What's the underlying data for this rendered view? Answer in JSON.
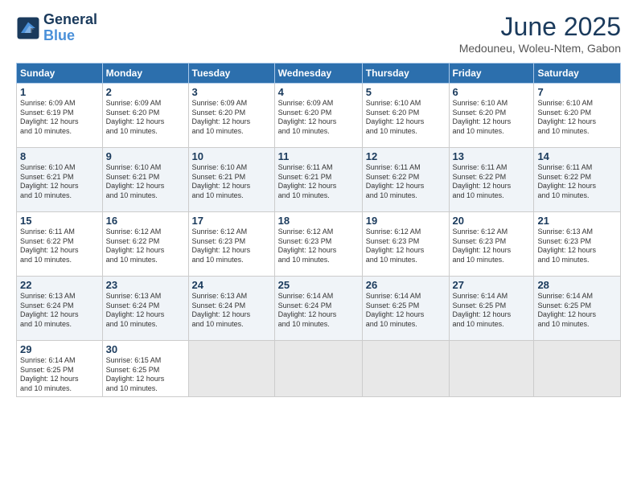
{
  "logo": {
    "line1": "General",
    "line2": "Blue"
  },
  "title": "June 2025",
  "subtitle": "Medouneu, Woleu-Ntem, Gabon",
  "header_days": [
    "Sunday",
    "Monday",
    "Tuesday",
    "Wednesday",
    "Thursday",
    "Friday",
    "Saturday"
  ],
  "weeks": [
    [
      {
        "day": "1",
        "sunrise": "6:09 AM",
        "sunset": "6:19 PM",
        "daylight": "12 hours and 10 minutes."
      },
      {
        "day": "2",
        "sunrise": "6:09 AM",
        "sunset": "6:20 PM",
        "daylight": "12 hours and 10 minutes."
      },
      {
        "day": "3",
        "sunrise": "6:09 AM",
        "sunset": "6:20 PM",
        "daylight": "12 hours and 10 minutes."
      },
      {
        "day": "4",
        "sunrise": "6:09 AM",
        "sunset": "6:20 PM",
        "daylight": "12 hours and 10 minutes."
      },
      {
        "day": "5",
        "sunrise": "6:10 AM",
        "sunset": "6:20 PM",
        "daylight": "12 hours and 10 minutes."
      },
      {
        "day": "6",
        "sunrise": "6:10 AM",
        "sunset": "6:20 PM",
        "daylight": "12 hours and 10 minutes."
      },
      {
        "day": "7",
        "sunrise": "6:10 AM",
        "sunset": "6:20 PM",
        "daylight": "12 hours and 10 minutes."
      }
    ],
    [
      {
        "day": "8",
        "sunrise": "6:10 AM",
        "sunset": "6:21 PM",
        "daylight": "12 hours and 10 minutes."
      },
      {
        "day": "9",
        "sunrise": "6:10 AM",
        "sunset": "6:21 PM",
        "daylight": "12 hours and 10 minutes."
      },
      {
        "day": "10",
        "sunrise": "6:10 AM",
        "sunset": "6:21 PM",
        "daylight": "12 hours and 10 minutes."
      },
      {
        "day": "11",
        "sunrise": "6:11 AM",
        "sunset": "6:21 PM",
        "daylight": "12 hours and 10 minutes."
      },
      {
        "day": "12",
        "sunrise": "6:11 AM",
        "sunset": "6:22 PM",
        "daylight": "12 hours and 10 minutes."
      },
      {
        "day": "13",
        "sunrise": "6:11 AM",
        "sunset": "6:22 PM",
        "daylight": "12 hours and 10 minutes."
      },
      {
        "day": "14",
        "sunrise": "6:11 AM",
        "sunset": "6:22 PM",
        "daylight": "12 hours and 10 minutes."
      }
    ],
    [
      {
        "day": "15",
        "sunrise": "6:11 AM",
        "sunset": "6:22 PM",
        "daylight": "12 hours and 10 minutes."
      },
      {
        "day": "16",
        "sunrise": "6:12 AM",
        "sunset": "6:22 PM",
        "daylight": "12 hours and 10 minutes."
      },
      {
        "day": "17",
        "sunrise": "6:12 AM",
        "sunset": "6:23 PM",
        "daylight": "12 hours and 10 minutes."
      },
      {
        "day": "18",
        "sunrise": "6:12 AM",
        "sunset": "6:23 PM",
        "daylight": "12 hours and 10 minutes."
      },
      {
        "day": "19",
        "sunrise": "6:12 AM",
        "sunset": "6:23 PM",
        "daylight": "12 hours and 10 minutes."
      },
      {
        "day": "20",
        "sunrise": "6:12 AM",
        "sunset": "6:23 PM",
        "daylight": "12 hours and 10 minutes."
      },
      {
        "day": "21",
        "sunrise": "6:13 AM",
        "sunset": "6:23 PM",
        "daylight": "12 hours and 10 minutes."
      }
    ],
    [
      {
        "day": "22",
        "sunrise": "6:13 AM",
        "sunset": "6:24 PM",
        "daylight": "12 hours and 10 minutes."
      },
      {
        "day": "23",
        "sunrise": "6:13 AM",
        "sunset": "6:24 PM",
        "daylight": "12 hours and 10 minutes."
      },
      {
        "day": "24",
        "sunrise": "6:13 AM",
        "sunset": "6:24 PM",
        "daylight": "12 hours and 10 minutes."
      },
      {
        "day": "25",
        "sunrise": "6:14 AM",
        "sunset": "6:24 PM",
        "daylight": "12 hours and 10 minutes."
      },
      {
        "day": "26",
        "sunrise": "6:14 AM",
        "sunset": "6:25 PM",
        "daylight": "12 hours and 10 minutes."
      },
      {
        "day": "27",
        "sunrise": "6:14 AM",
        "sunset": "6:25 PM",
        "daylight": "12 hours and 10 minutes."
      },
      {
        "day": "28",
        "sunrise": "6:14 AM",
        "sunset": "6:25 PM",
        "daylight": "12 hours and 10 minutes."
      }
    ],
    [
      {
        "day": "29",
        "sunrise": "6:14 AM",
        "sunset": "6:25 PM",
        "daylight": "12 hours and 10 minutes."
      },
      {
        "day": "30",
        "sunrise": "6:15 AM",
        "sunset": "6:25 PM",
        "daylight": "12 hours and 10 minutes."
      },
      null,
      null,
      null,
      null,
      null
    ]
  ]
}
